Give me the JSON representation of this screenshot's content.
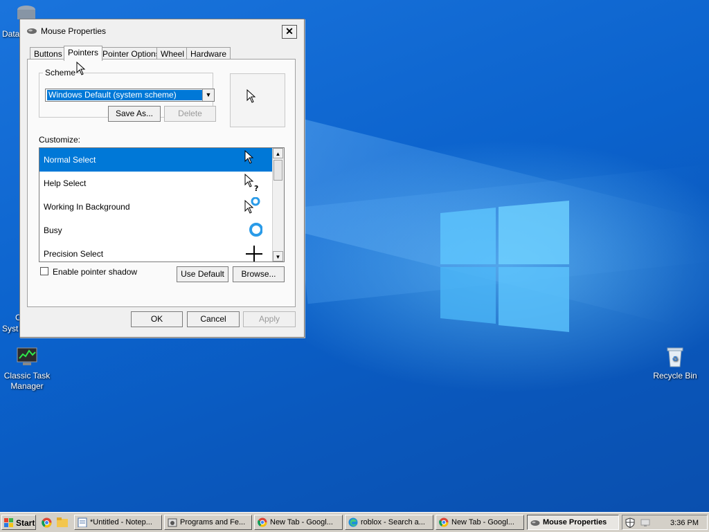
{
  "desktop": {
    "icons": [
      {
        "label": "Classic Task Manager"
      },
      {
        "label": "Recycle Bin"
      }
    ],
    "partial_labels": [
      "Data",
      "C",
      "Syst"
    ]
  },
  "dialog": {
    "title": "Mouse Properties",
    "close_label": "✕",
    "tabs": [
      {
        "label": "Buttons",
        "active": false
      },
      {
        "label": "Pointers",
        "active": true
      },
      {
        "label": "Pointer Options",
        "active": false
      },
      {
        "label": "Wheel",
        "active": false
      },
      {
        "label": "Hardware",
        "active": false
      }
    ],
    "scheme": {
      "legend": "Scheme",
      "selected": "Windows Default (system scheme)",
      "save_as_label": "Save As...",
      "delete_label": "Delete"
    },
    "customize": {
      "label": "Customize:",
      "items": [
        {
          "label": "Normal Select",
          "cursor_icon": "arrow-cursor-icon",
          "selected": true
        },
        {
          "label": "Help Select",
          "cursor_icon": "help-cursor-icon",
          "selected": false
        },
        {
          "label": "Working In Background",
          "cursor_icon": "working-cursor-icon",
          "selected": false
        },
        {
          "label": "Busy",
          "cursor_icon": "busy-cursor-icon",
          "selected": false
        },
        {
          "label": "Precision Select",
          "cursor_icon": "crosshair-cursor-icon",
          "selected": false
        }
      ]
    },
    "shadow_label": "Enable pointer shadow",
    "shadow_checked": false,
    "use_default_label": "Use Default",
    "browse_label": "Browse...",
    "ok_label": "OK",
    "cancel_label": "Cancel",
    "apply_label": "Apply"
  },
  "taskbar": {
    "start_label": "Start",
    "buttons": [
      {
        "label": "*Untitled - Notep...",
        "icon": "notepad-icon",
        "active": false
      },
      {
        "label": "Programs and Fe...",
        "icon": "programs-icon",
        "active": false
      },
      {
        "label": "New Tab - Googl...",
        "icon": "chrome-icon",
        "active": false
      },
      {
        "label": "roblox - Search a...",
        "icon": "edge-icon",
        "active": false
      },
      {
        "label": "New Tab - Googl...",
        "icon": "chrome-icon",
        "active": false
      },
      {
        "label": "Mouse Properties",
        "icon": "mouse-icon",
        "active": true
      }
    ],
    "clock": "3:36 PM"
  },
  "colors": {
    "selection": "#0078d7",
    "desktop": "#0b62cc",
    "taskbar": "#d4d0c8"
  }
}
